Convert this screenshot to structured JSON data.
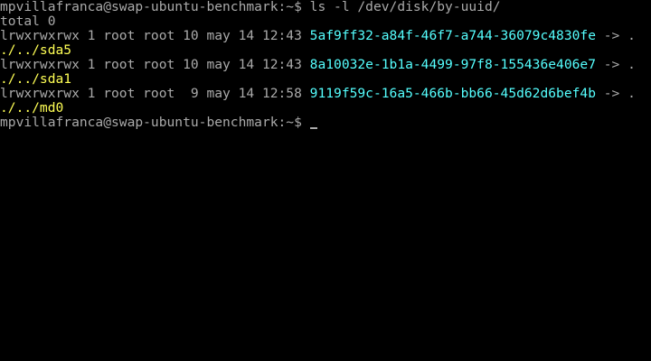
{
  "terminal": {
    "prompt": "mpvillafranca@swap-ubuntu-benchmark:~$ ",
    "command": "ls -l /dev/disk/by-uuid/",
    "total": "total 0",
    "entries": [
      {
        "meta": "lrwxrwxrwx 1 root root 10 may 14 12:43 ",
        "uuid": "5af9ff32-a84f-46f7-a744-36079c4830fe",
        "arrow": " -> .",
        "target": "./../sda5"
      },
      {
        "meta": "lrwxrwxrwx 1 root root 10 may 14 12:43 ",
        "uuid": "8a10032e-1b1a-4499-97f8-155436e406e7",
        "arrow": " -> .",
        "target": "./../sda1"
      },
      {
        "meta": "lrwxrwxrwx 1 root root  9 may 14 12:58 ",
        "uuid": "9119f59c-16a5-466b-bb66-45d62d6bef4b",
        "arrow": " -> .",
        "target": "./../md0"
      }
    ],
    "final_prompt": "mpvillafranca@swap-ubuntu-benchmark:~$ "
  },
  "colors": {
    "background": "#000000",
    "text": "#aaaaaa",
    "symlink_name": "#55ffff",
    "symlink_target": "#ffff55"
  }
}
